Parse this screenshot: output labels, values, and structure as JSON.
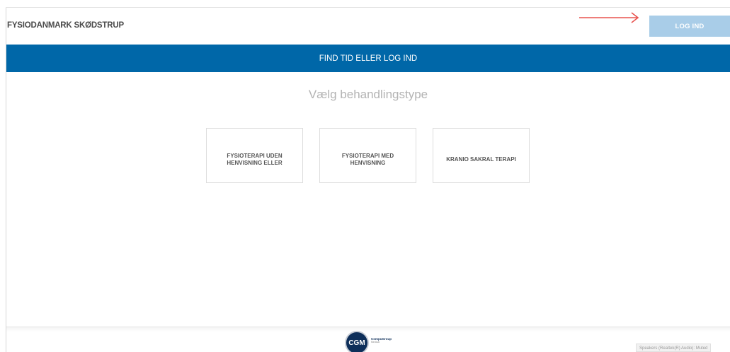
{
  "header": {
    "clinic_name": "FYSIODANMARK SKØDSTRUP",
    "login_label": "LOG IND"
  },
  "banner": {
    "title": "FIND TID ELLER LOG IND"
  },
  "main": {
    "subtitle": "Vælg behandlingstype",
    "treatments": [
      {
        "label": "FYSIOTERAPI UDEN HENVISNING ELLER"
      },
      {
        "label": "FYSIOTERAPI MED HENVISNING"
      },
      {
        "label": "KRANIO SAKRAL TERAPI"
      }
    ]
  },
  "footer": {
    "logo_mark": "CGM",
    "logo_name": "CompuGroup",
    "logo_sub": "Medical"
  },
  "system": {
    "speaker_status": "Speakers (Realtek(R) Audio): Muted"
  },
  "colors": {
    "brand_blue": "#0067a8",
    "login_button": "#a9cde8",
    "arrow": "#e8534f"
  },
  "icons": {
    "arrow": "arrow-right-icon"
  }
}
